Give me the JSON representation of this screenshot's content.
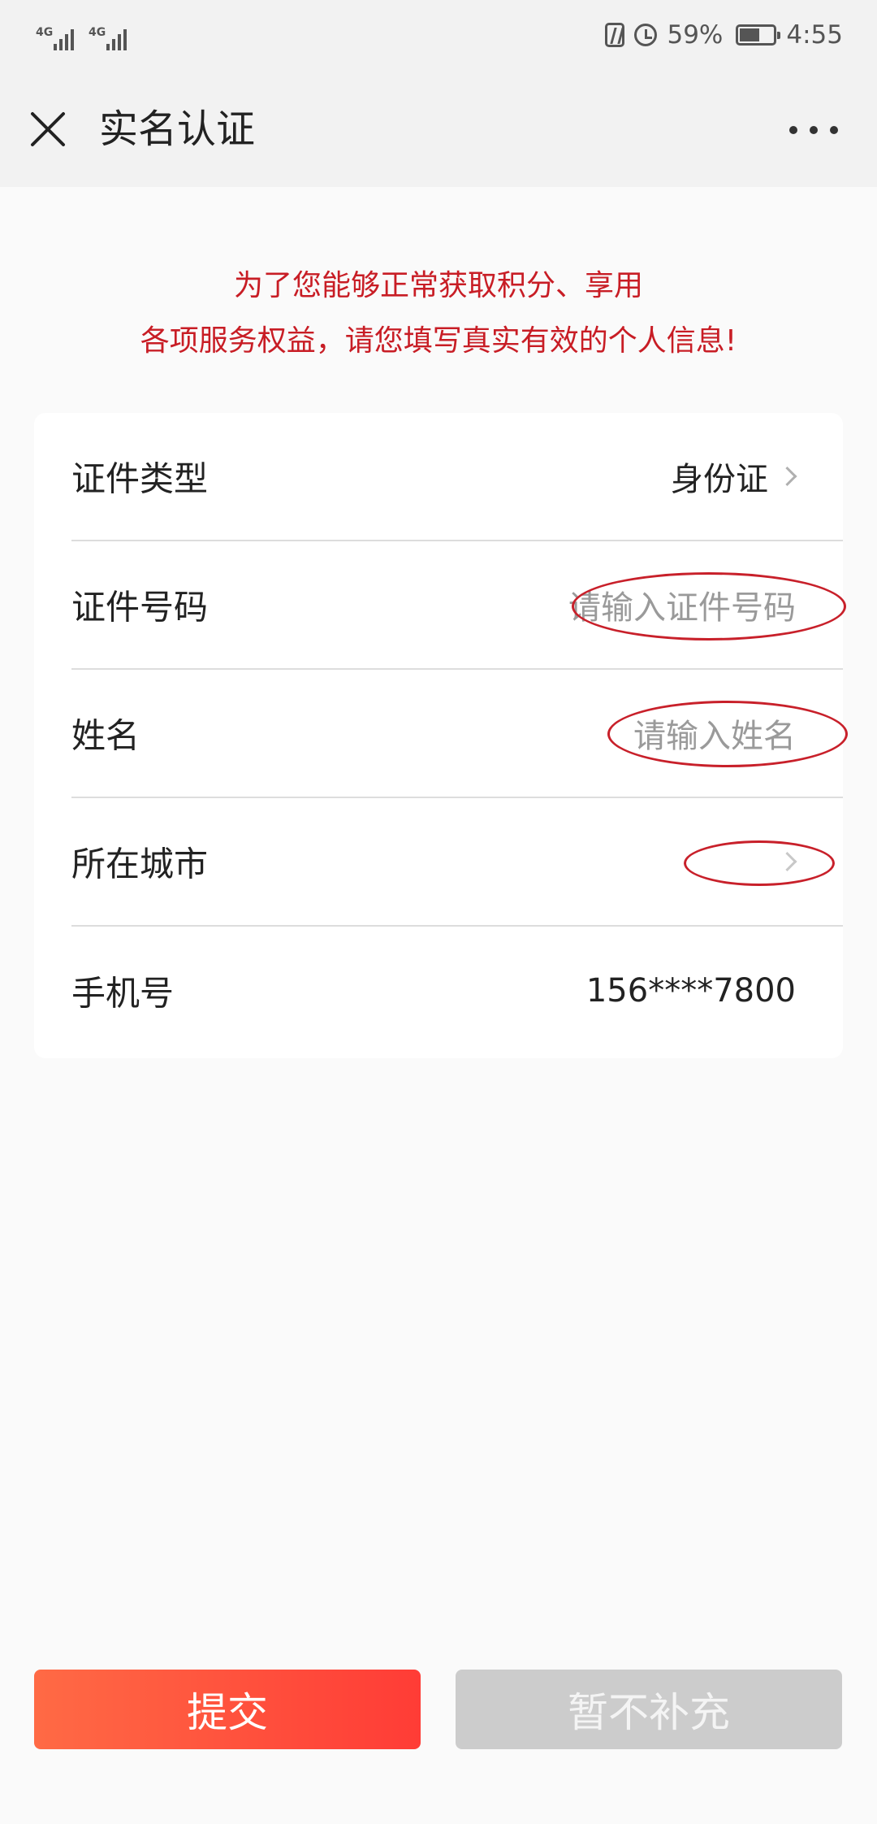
{
  "status_bar": {
    "signal_1": "4G",
    "signal_2": "4G",
    "battery_percent": "59%",
    "battery_level": 0.59,
    "time": "4:55"
  },
  "header": {
    "title": "实名认证"
  },
  "notice": {
    "line1": "为了您能够正常获取积分、享用",
    "line2": "各项服务权益，请您填写真实有效的个人信息!",
    "color": "#c81d25"
  },
  "form": {
    "id_type": {
      "label": "证件类型",
      "value": "身份证"
    },
    "id_number": {
      "label": "证件号码",
      "placeholder": "请输入证件号码"
    },
    "name": {
      "label": "姓名",
      "placeholder": "请输入姓名"
    },
    "city": {
      "label": "所在城市",
      "value": ""
    },
    "phone": {
      "label": "手机号",
      "value": "156****7800"
    }
  },
  "buttons": {
    "submit": "提交",
    "skip": "暂不补充"
  },
  "colors": {
    "accent_start": "#ff6a45",
    "accent_end": "#ff3c36",
    "highlight_ring": "#c8202a"
  },
  "icons": [
    "close-icon",
    "more-icon",
    "chevron-right-icon",
    "nfc-icon",
    "alarm-icon",
    "battery-icon"
  ]
}
